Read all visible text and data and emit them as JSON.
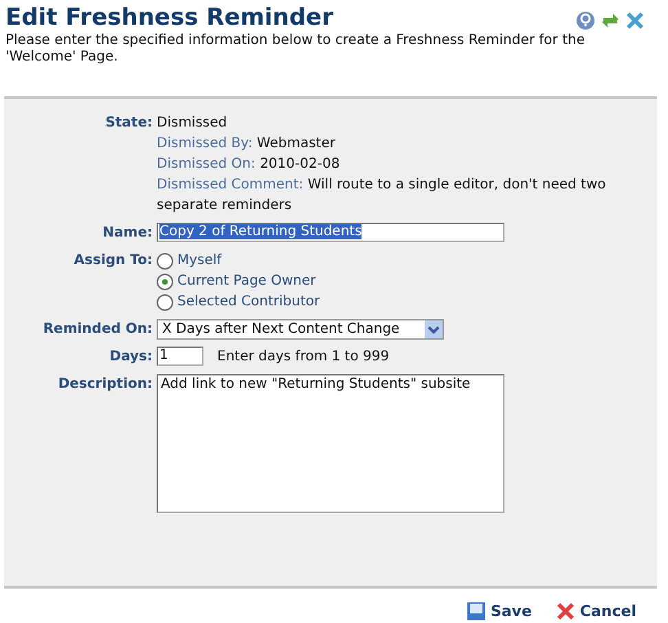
{
  "title": "Edit Freshness Reminder",
  "intro": "Please enter the specified information below to create a Freshness Reminder for the 'Welcome' Page.",
  "state": {
    "label": "State:",
    "value": "Dismissed",
    "details": [
      {
        "label": "Dismissed By:",
        "value": "Webmaster"
      },
      {
        "label": "Dismissed On:",
        "value": "2010-02-08"
      },
      {
        "label": "Dismissed Comment:",
        "value": "Will route to a single editor, don't need two separate reminders"
      }
    ]
  },
  "name": {
    "label": "Name:",
    "value": "Copy 2 of Returning Students",
    "text_selected": true
  },
  "assign_to": {
    "label": "Assign To:",
    "options": [
      {
        "label": "Myself",
        "selected": false
      },
      {
        "label": "Current Page Owner",
        "selected": true
      },
      {
        "label": "Selected Contributor",
        "selected": false
      }
    ]
  },
  "reminded_on": {
    "label": "Reminded On:",
    "value": "X Days after Next Content Change"
  },
  "days": {
    "label": "Days:",
    "value": "1",
    "hint": "Enter days from 1 to 999"
  },
  "description": {
    "label": "Description:",
    "value": "Add link to new \"Returning Students\" subsite"
  },
  "buttons": [
    {
      "kind": "save",
      "label": "Save"
    },
    {
      "kind": "cancel",
      "label": "Cancel"
    }
  ]
}
